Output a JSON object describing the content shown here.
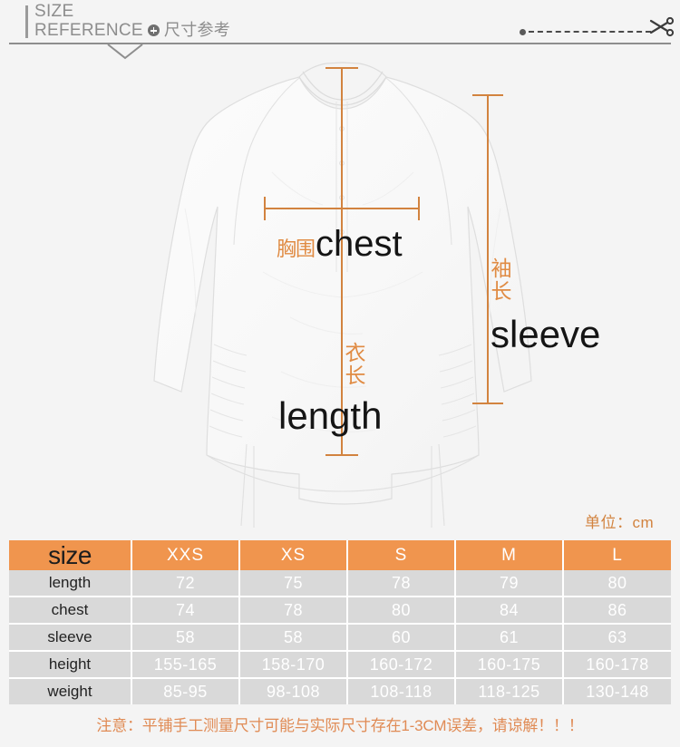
{
  "header": {
    "line1": "SIZE",
    "line2_en": "REFERENCE",
    "line2_cn": "尺寸参考",
    "plus_icon": "plus-circle-icon",
    "scissors_icon": "scissors-icon",
    "chevron_icon": "chevron-down-icon"
  },
  "annotations": {
    "chest_cn": "胸围",
    "chest_en": "chest",
    "sleeve_cn": "袖长",
    "sleeve_en": "sleeve",
    "length_cn": "衣长",
    "length_en": "length"
  },
  "unit_label": "单位：cm",
  "colors": {
    "accent_orange": "#f0954e",
    "annotation_orange": "#e08b43",
    "cell_gray": "#d9d9d9",
    "page_background": "#f4f4f4",
    "header_gray": "#8d8d8d"
  },
  "table": {
    "header": [
      "size",
      "XXS",
      "XS",
      "S",
      "M",
      "L"
    ],
    "rows": [
      {
        "label": "length",
        "values": [
          "72",
          "75",
          "78",
          "79",
          "80"
        ]
      },
      {
        "label": "chest",
        "values": [
          "74",
          "78",
          "80",
          "84",
          "86"
        ]
      },
      {
        "label": "sleeve",
        "values": [
          "58",
          "58",
          "60",
          "61",
          "63"
        ]
      },
      {
        "label": "height",
        "values": [
          "155-165",
          "158-170",
          "160-172",
          "160-175",
          "160-178"
        ]
      },
      {
        "label": "weight",
        "values": [
          "85-95",
          "98-108",
          "108-118",
          "118-125",
          "130-148"
        ]
      }
    ]
  },
  "note": "注意：平铺手工测量尺寸可能与实际尺寸存在1-3CM误差，请谅解！！！"
}
